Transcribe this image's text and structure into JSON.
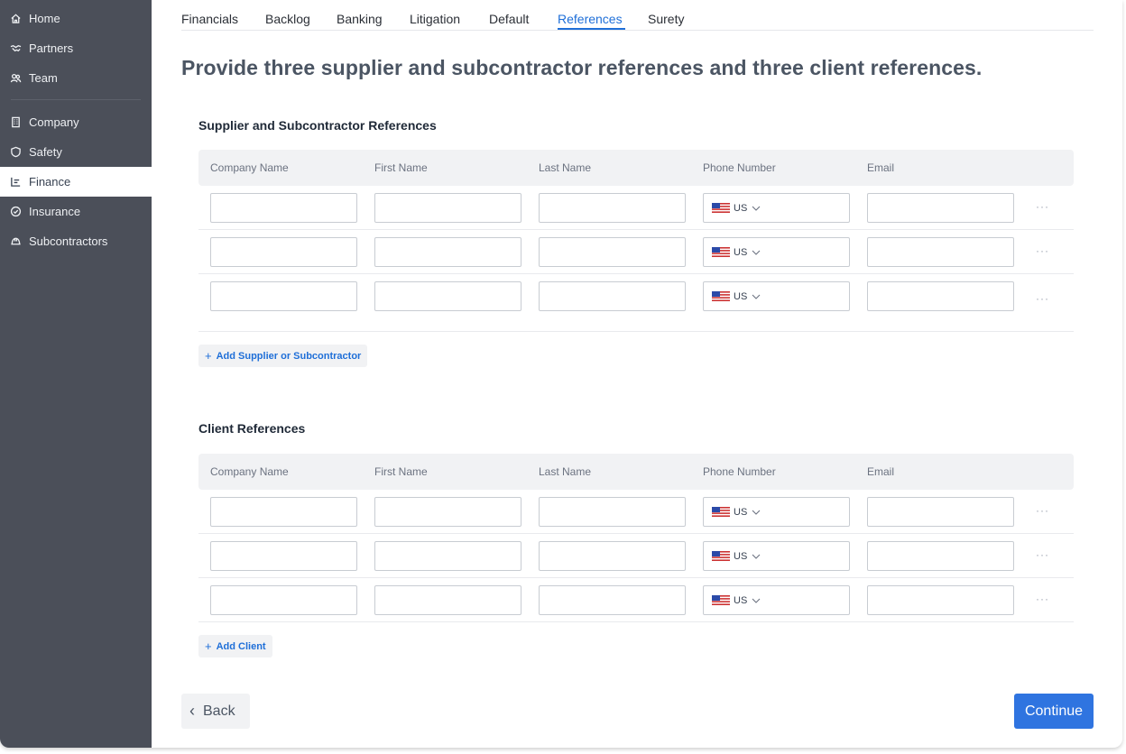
{
  "sidebar": {
    "items": [
      {
        "label": "Home",
        "icon": "home-icon"
      },
      {
        "label": "Partners",
        "icon": "handshake-icon"
      },
      {
        "label": "Team",
        "icon": "team-icon"
      },
      {
        "label": "Company",
        "icon": "building-icon"
      },
      {
        "label": "Safety",
        "icon": "shield-icon"
      },
      {
        "label": "Finance",
        "icon": "chart-icon",
        "active": true
      },
      {
        "label": "Insurance",
        "icon": "check-circle-icon"
      },
      {
        "label": "Subcontractors",
        "icon": "hardhat-icon"
      }
    ]
  },
  "tabs": [
    {
      "label": "Financials"
    },
    {
      "label": "Backlog"
    },
    {
      "label": "Banking"
    },
    {
      "label": "Litigation"
    },
    {
      "label": "Default"
    },
    {
      "label": "References",
      "active": true
    },
    {
      "label": "Surety"
    }
  ],
  "page_title": "Provide three supplier and subcontractor references and three client references.",
  "columns": [
    "Company Name",
    "First Name",
    "Last Name",
    "Phone Number",
    "Email"
  ],
  "supplier_section": {
    "title": "Supplier and Subcontractor References",
    "rows": [
      {
        "company": "",
        "first": "",
        "last": "",
        "country": "US",
        "email": ""
      },
      {
        "company": "",
        "first": "",
        "last": "",
        "country": "US",
        "email": ""
      },
      {
        "company": "",
        "first": "",
        "last": "",
        "country": "US",
        "email": ""
      }
    ],
    "add_label": "Add Supplier or Subcontractor"
  },
  "client_section": {
    "title": "Client References",
    "rows": [
      {
        "company": "",
        "first": "",
        "last": "",
        "country": "US",
        "email": ""
      },
      {
        "company": "",
        "first": "",
        "last": "",
        "country": "US",
        "email": ""
      },
      {
        "company": "",
        "first": "",
        "last": "",
        "country": "US",
        "email": ""
      }
    ],
    "add_label": "Add Client"
  },
  "more_label": "···",
  "footer": {
    "back_label": "Back",
    "continue_label": "Continue"
  },
  "colors": {
    "accent": "#2f74e0",
    "sidebar": "#4b4f59",
    "tab_active": "#1f6fd8"
  }
}
